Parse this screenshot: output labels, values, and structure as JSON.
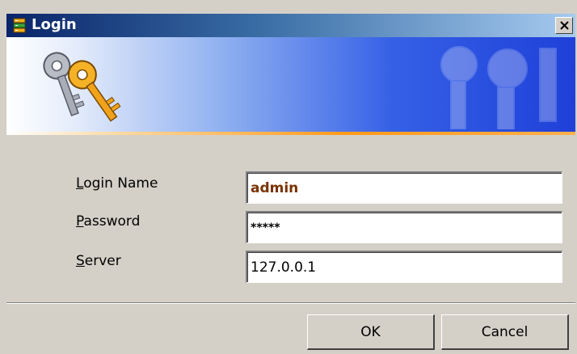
{
  "window": {
    "title": "Login",
    "close_glyph": "X"
  },
  "icons": {
    "app": "database-stack-icon",
    "banner": "keys-icon",
    "watermark": "keys-watermark-icon",
    "close": "close-icon"
  },
  "colors": {
    "titlebar_start": "#0a246a",
    "titlebar_end": "#a6caf0",
    "banner_blue": "#1f40d8",
    "accent_orange": "#ff9a1a",
    "login_value": "#7a3200",
    "dialog_bg": "#d4d0c8"
  },
  "form": {
    "login_name": {
      "label_first": "L",
      "label_rest": "ogin Name",
      "value": "admin"
    },
    "password": {
      "label_first": "P",
      "label_rest": "assword",
      "value": "*****"
    },
    "server": {
      "label_first": "S",
      "label_rest": "erver",
      "value": "127.0.0.1"
    }
  },
  "buttons": {
    "ok": "OK",
    "cancel": "Cancel"
  }
}
